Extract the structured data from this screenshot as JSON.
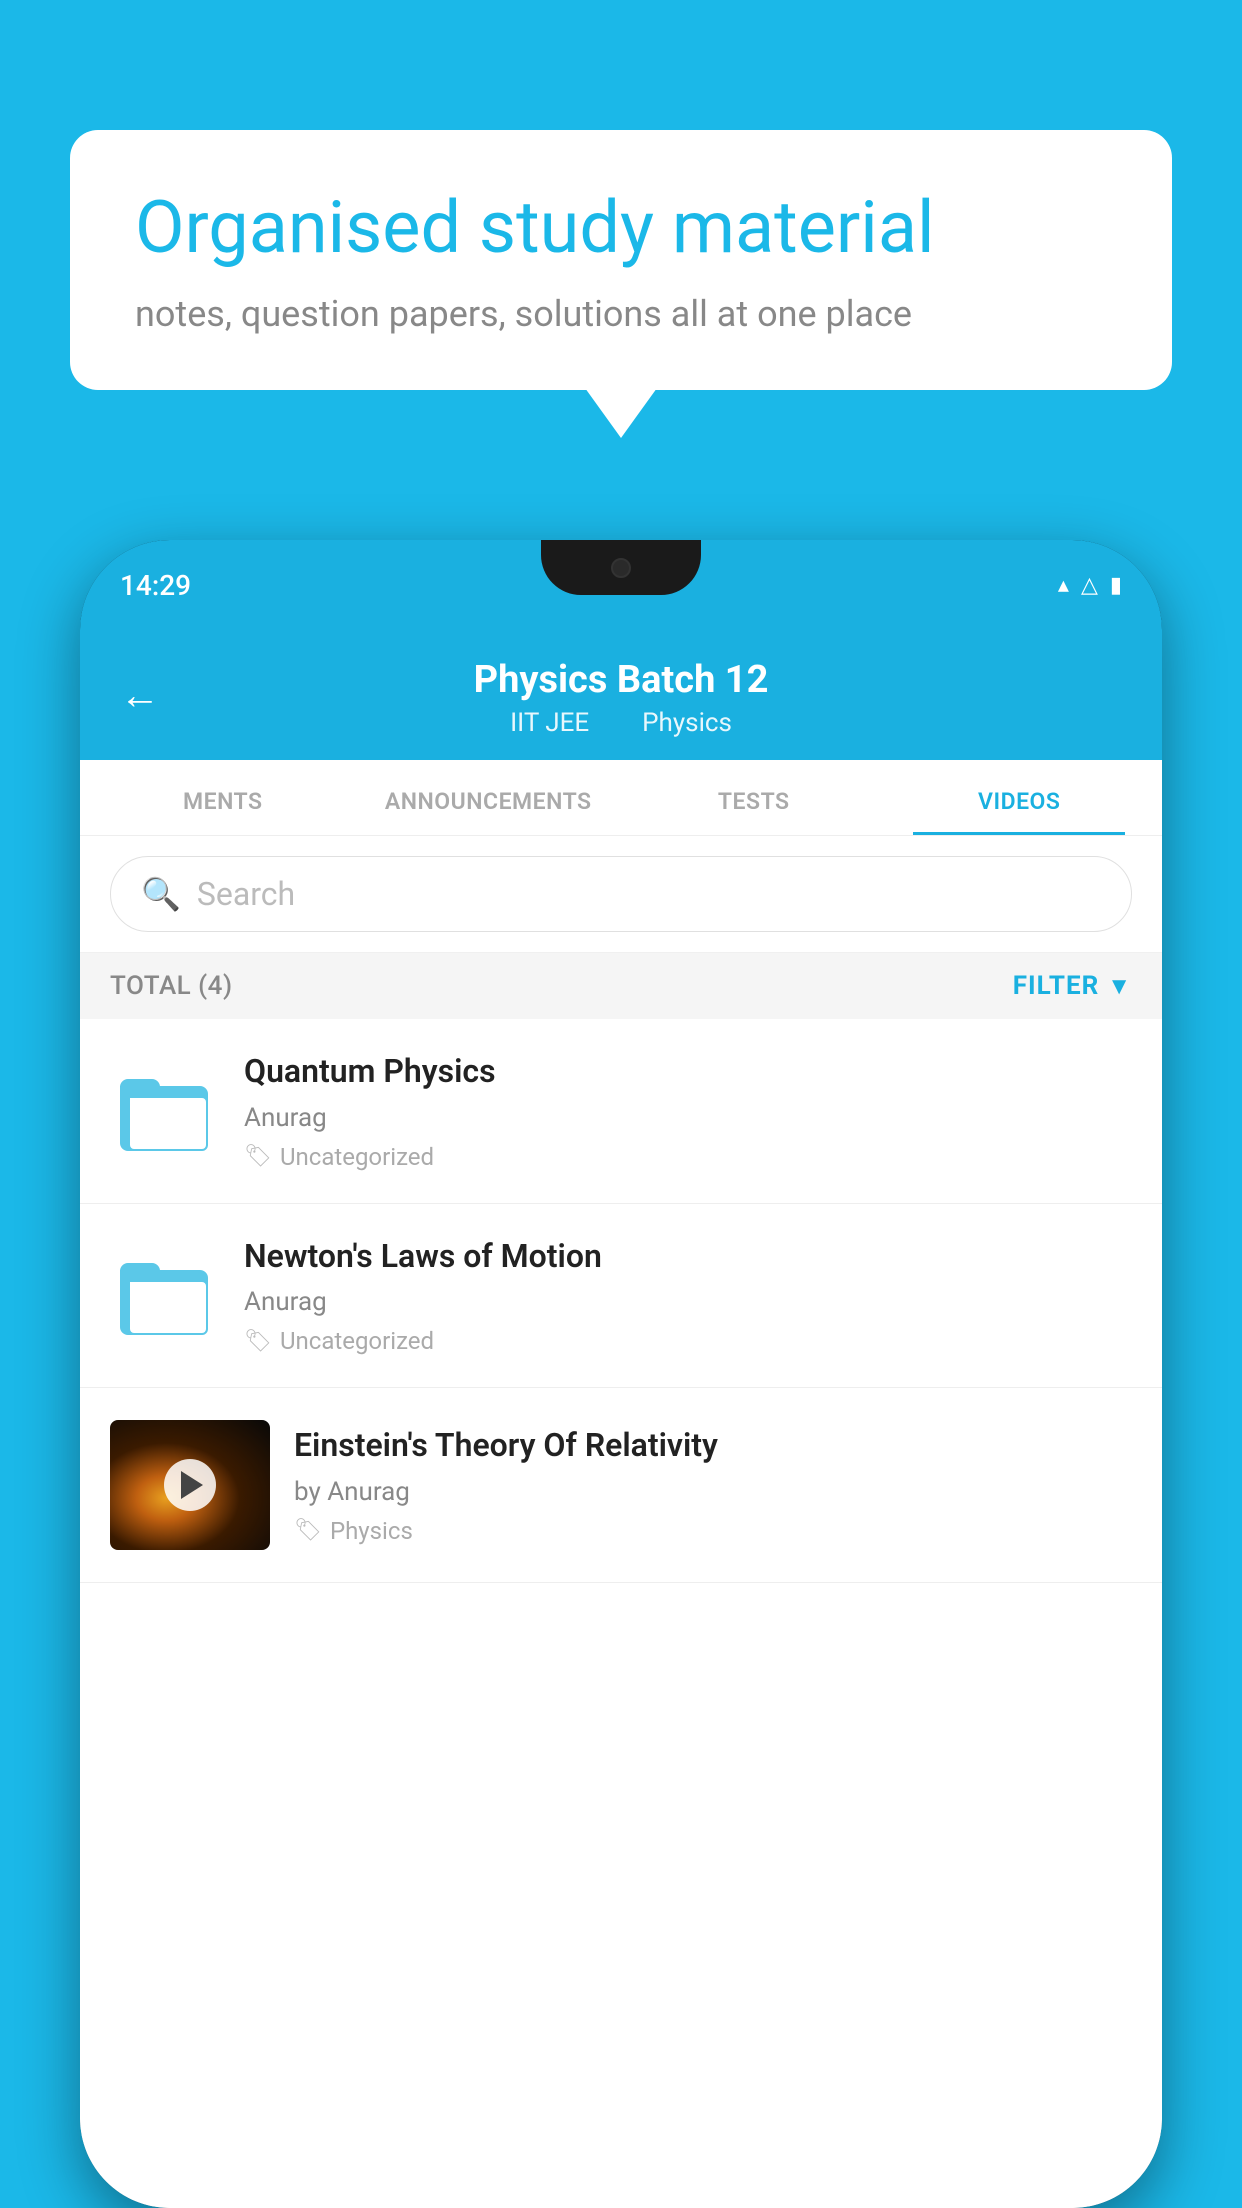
{
  "background_color": "#1bb8e8",
  "speech_bubble": {
    "title": "Organised study material",
    "subtitle": "notes, question papers, solutions all at one place"
  },
  "phone": {
    "status_bar": {
      "time": "14:29",
      "icons": [
        "wifi",
        "signal",
        "battery"
      ]
    },
    "app": {
      "header": {
        "back_label": "←",
        "title": "Physics Batch 12",
        "tags": [
          "IIT JEE",
          "Physics"
        ]
      },
      "tabs": [
        {
          "label": "MENTS",
          "active": false
        },
        {
          "label": "ANNOUNCEMENTS",
          "active": false
        },
        {
          "label": "TESTS",
          "active": false
        },
        {
          "label": "VIDEOS",
          "active": true
        }
      ],
      "search": {
        "placeholder": "Search"
      },
      "filter_bar": {
        "total_label": "TOTAL (4)",
        "filter_label": "FILTER"
      },
      "video_items": [
        {
          "title": "Quantum Physics",
          "author": "Anurag",
          "tag": "Uncategorized",
          "type": "folder",
          "has_thumbnail": false
        },
        {
          "title": "Newton's Laws of Motion",
          "author": "Anurag",
          "tag": "Uncategorized",
          "type": "folder",
          "has_thumbnail": false
        },
        {
          "title": "Einstein's Theory Of Relativity",
          "author": "by Anurag",
          "tag": "Physics",
          "type": "video",
          "has_thumbnail": true
        }
      ]
    }
  }
}
